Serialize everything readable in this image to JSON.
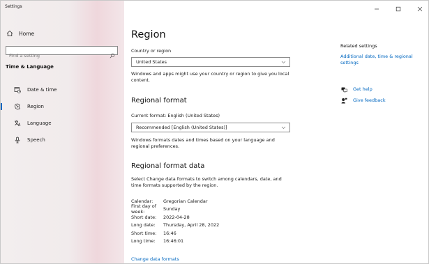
{
  "window": {
    "title": "Settings"
  },
  "sidebar": {
    "home_label": "Home",
    "search_placeholder": "Find a setting",
    "section_title": "Time & Language",
    "items": [
      {
        "label": "Date & time",
        "icon": "calendar-clock-icon",
        "active": false
      },
      {
        "label": "Region",
        "icon": "region-globe-icon",
        "active": true
      },
      {
        "label": "Language",
        "icon": "language-icon",
        "active": false
      },
      {
        "label": "Speech",
        "icon": "microphone-icon",
        "active": false
      }
    ]
  },
  "main": {
    "title": "Region",
    "country": {
      "label": "Country or region",
      "value": "United States",
      "description": "Windows and apps might use your country or region to give you local content."
    },
    "regional_format": {
      "heading": "Regional format",
      "current_label": "Current format: English (United States)",
      "value": "Recommended [English (United States)]",
      "description": "Windows formats dates and times based on your language and regional preferences."
    },
    "format_data": {
      "heading": "Regional format data",
      "description": "Select Change data formats to switch among calendars, date, and time formats supported by the region.",
      "rows": [
        {
          "key": "Calendar:",
          "value": "Gregorian Calendar"
        },
        {
          "key": "First day of week:",
          "value": "Sunday"
        },
        {
          "key": "Short date:",
          "value": "2022-04-28"
        },
        {
          "key": "Long date:",
          "value": "Thursday, April 28, 2022"
        },
        {
          "key": "Short time:",
          "value": "16:46"
        },
        {
          "key": "Long time:",
          "value": "16:46:01"
        }
      ],
      "change_link": "Change data formats"
    }
  },
  "related": {
    "title": "Related settings",
    "link": "Additional date, time & regional settings",
    "get_help": "Get help",
    "give_feedback": "Give feedback"
  },
  "colors": {
    "accent": "#0067c0"
  }
}
